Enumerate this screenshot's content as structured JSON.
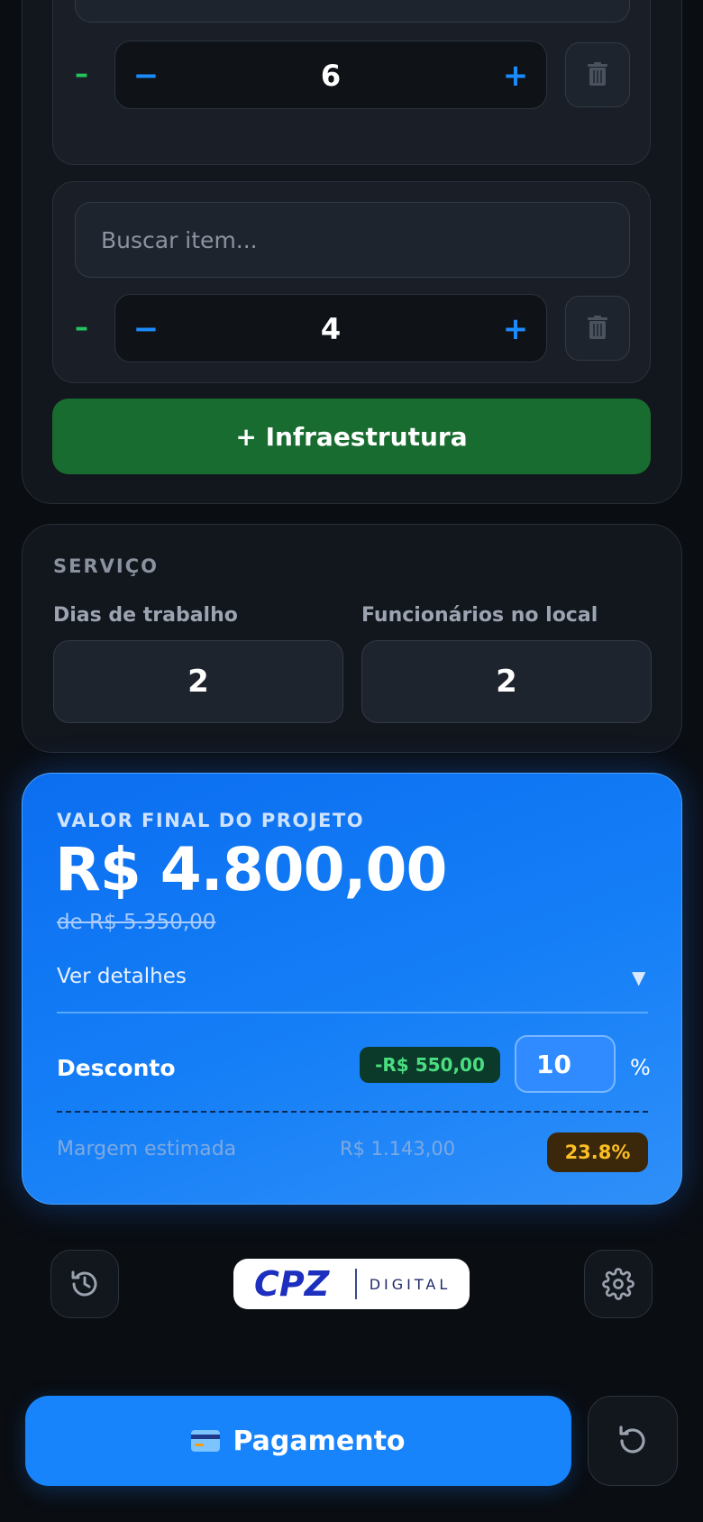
{
  "items": [
    {
      "search_placeholder": "Buscar item...",
      "quantity": "6",
      "remove_symbol": "–",
      "dec_symbol": "−",
      "inc_symbol": "+"
    },
    {
      "search_placeholder": "Buscar item...",
      "quantity": "4",
      "remove_symbol": "–",
      "dec_symbol": "−",
      "inc_symbol": "+"
    }
  ],
  "add_infra_label": "+ Infraestrutura",
  "service": {
    "title": "SERVIÇO",
    "days_label": "Dias de trabalho",
    "days_value": "2",
    "staff_label": "Funcionários no local",
    "staff_value": "2"
  },
  "summary": {
    "caption": "VALOR FINAL DO PROJETO",
    "final_value": "R$ 4.800,00",
    "original_value": "de R$ 5.350,00",
    "details_label": "Ver detalhes",
    "details_arrow": "▼",
    "discount_label": "Desconto",
    "discount_amount": "-R$ 550,00",
    "discount_percent": "10",
    "percent_symbol": "%",
    "margin_label": "Margem estimada",
    "margin_value": "R$ 1.143,00",
    "margin_percent": "23.8%"
  },
  "logo": {
    "brand": "CPZ",
    "suffix": "DIGITAL"
  },
  "payment_label": "Pagamento",
  "colors": {
    "accent": "#1784fb",
    "success": "#186c30",
    "warning": "#fbbf24"
  },
  "icons": {
    "history": "history-icon",
    "settings": "gear-icon",
    "reset": "reset-icon",
    "trash": "trash-icon",
    "card": "credit-card-icon"
  }
}
